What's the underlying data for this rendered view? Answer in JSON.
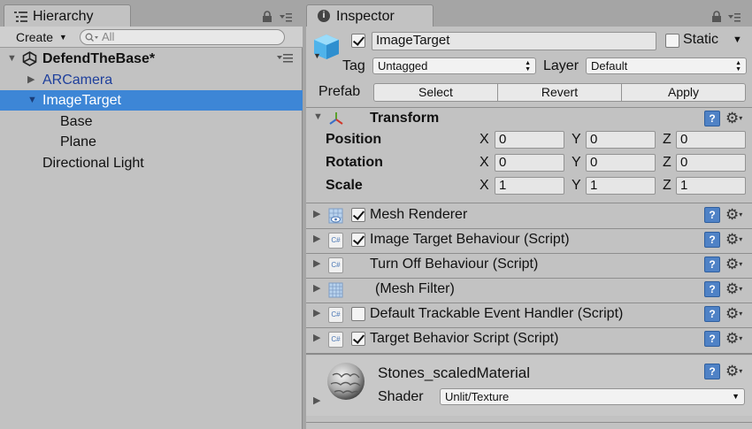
{
  "hierarchy": {
    "tab_label": "Hierarchy",
    "create_label": "Create",
    "search_placeholder": "All",
    "scene": "DefendTheBase*",
    "items": [
      {
        "label": "ARCamera"
      },
      {
        "label": "ImageTarget"
      },
      {
        "label": "Base"
      },
      {
        "label": "Plane"
      },
      {
        "label": "Directional Light"
      }
    ]
  },
  "inspector": {
    "tab_label": "Inspector",
    "object_name": "ImageTarget",
    "active": true,
    "static_label": "Static",
    "static_checked": false,
    "tag_label": "Tag",
    "tag_value": "Untagged",
    "layer_label": "Layer",
    "layer_value": "Default",
    "prefab_label": "Prefab",
    "prefab_buttons": [
      "Select",
      "Revert",
      "Apply"
    ],
    "transform": {
      "title": "Transform",
      "rows": [
        {
          "label": "Position",
          "x": "0",
          "y": "0",
          "z": "0"
        },
        {
          "label": "Rotation",
          "x": "0",
          "y": "0",
          "z": "0"
        },
        {
          "label": "Scale",
          "x": "1",
          "y": "1",
          "z": "1"
        }
      ],
      "axes": [
        "X",
        "Y",
        "Z"
      ]
    },
    "components": [
      {
        "name": "Mesh Renderer",
        "enabled": true,
        "icon": "mesh-renderer-icon"
      },
      {
        "name": "Image Target Behaviour (Script)",
        "enabled": true,
        "icon": "csharp-script-icon"
      },
      {
        "name": "Turn Off Behaviour (Script)",
        "enabled": null,
        "icon": "csharp-script-icon"
      },
      {
        "name": "(Mesh Filter)",
        "enabled": null,
        "icon": "mesh-filter-icon"
      },
      {
        "name": "Default Trackable Event Handler (Script)",
        "enabled": false,
        "icon": "csharp-script-icon"
      },
      {
        "name": "Target Behavior Script (Script)",
        "enabled": true,
        "icon": "csharp-script-icon"
      }
    ],
    "material": {
      "name": "Stones_scaledMaterial",
      "shader_label": "Shader",
      "shader_value": "Unlit/Texture"
    }
  },
  "colors": {
    "selection": "#3d86d6",
    "panel": "#c2c2c2",
    "hierarchy_link": "#1e3f9c"
  }
}
